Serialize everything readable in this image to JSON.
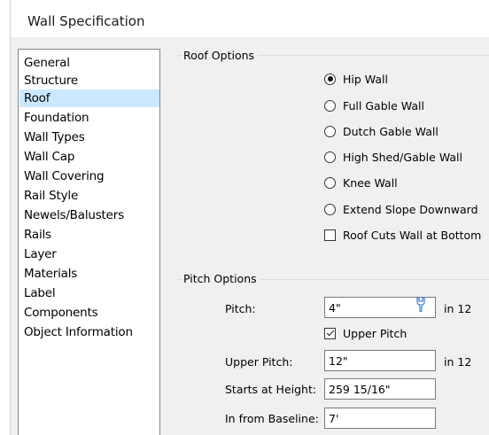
{
  "window": {
    "title": "Wall Specification"
  },
  "sidebar": {
    "items": [
      {
        "label": "General",
        "selected": false
      },
      {
        "label": "Structure",
        "selected": false
      },
      {
        "label": "Roof",
        "selected": true
      },
      {
        "label": "Foundation",
        "selected": false
      },
      {
        "label": "Wall Types",
        "selected": false
      },
      {
        "label": "Wall Cap",
        "selected": false
      },
      {
        "label": "Wall Covering",
        "selected": false
      },
      {
        "label": "Rail Style",
        "selected": false
      },
      {
        "label": "Newels/Balusters",
        "selected": false
      },
      {
        "label": "Rails",
        "selected": false
      },
      {
        "label": "Layer",
        "selected": false
      },
      {
        "label": "Materials",
        "selected": false
      },
      {
        "label": "Label",
        "selected": false
      },
      {
        "label": "Components",
        "selected": false
      },
      {
        "label": "Object Information",
        "selected": false
      }
    ]
  },
  "roof_options": {
    "title": "Roof Options",
    "options": [
      {
        "label": "Hip Wall",
        "type": "radio",
        "checked": true
      },
      {
        "label": "Full Gable Wall",
        "type": "radio",
        "checked": false
      },
      {
        "label": "Dutch Gable Wall",
        "type": "radio",
        "checked": false
      },
      {
        "label": "High Shed/Gable Wall",
        "type": "radio",
        "checked": false
      },
      {
        "label": "Knee Wall",
        "type": "radio",
        "checked": false
      },
      {
        "label": "Extend Slope Downward",
        "type": "radio",
        "checked": false
      },
      {
        "label": "Roof Cuts Wall at Bottom",
        "type": "checkbox",
        "checked": false
      }
    ]
  },
  "pitch_options": {
    "title": "Pitch Options",
    "pitch": {
      "label": "Pitch:",
      "value": "4\"",
      "unit": "in 12"
    },
    "upper_pitch_toggle": {
      "label": "Upper Pitch",
      "checked": true
    },
    "upper_pitch": {
      "label": "Upper Pitch:",
      "value": "12\"",
      "unit": "in 12"
    },
    "starts_at_height": {
      "label": "Starts at Height:",
      "value": "259 15/16\""
    },
    "in_from_baseline": {
      "label": "In from Baseline:",
      "value": "7'"
    }
  },
  "icons": {
    "pitch_tool": "wrench-icon"
  }
}
